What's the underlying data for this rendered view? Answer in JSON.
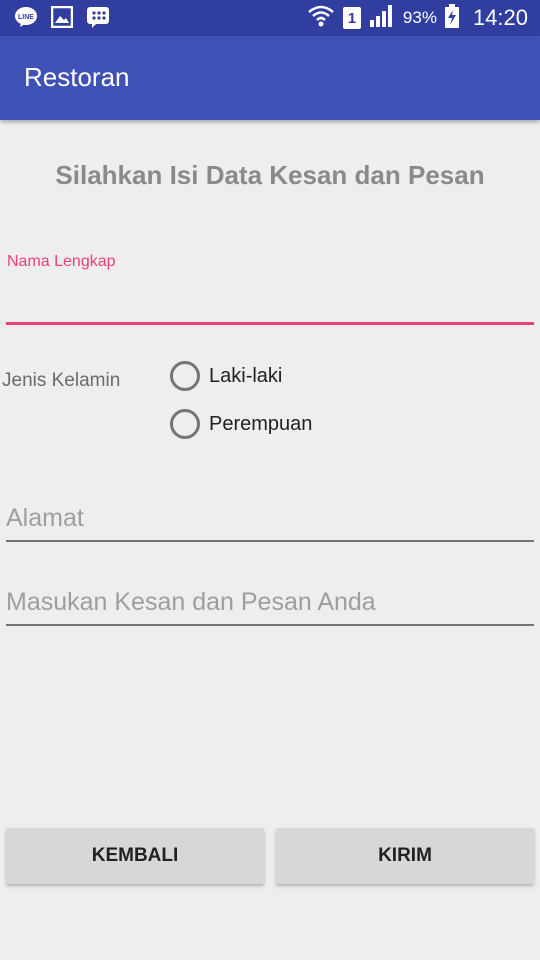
{
  "status_bar": {
    "icons_left": [
      "line-icon",
      "gallery-icon",
      "bbm-icon"
    ],
    "icons_right": [
      "wifi-icon",
      "sim-1-icon",
      "signal-icon",
      "battery-charging-icon"
    ],
    "sim_number": "1",
    "battery": "93%",
    "time": "14:20"
  },
  "app_bar": {
    "title": "Restoran",
    "color": "#3f51b5",
    "status_color": "#303f9f"
  },
  "form": {
    "heading": "Silahkan Isi Data Kesan dan Pesan",
    "name_field": {
      "label": "Nama Lengkap",
      "value": "",
      "accent": "#ec407a"
    },
    "gender": {
      "label": "Jenis Kelamin",
      "options": [
        "Laki-laki",
        "Perempuan"
      ],
      "selected": null
    },
    "address_field": {
      "placeholder": "Alamat",
      "value": ""
    },
    "message_field": {
      "placeholder": "Masukan Kesan dan Pesan Anda",
      "value": ""
    }
  },
  "buttons": {
    "back_label": "KEMBALI",
    "send_label": "KIRIM"
  }
}
